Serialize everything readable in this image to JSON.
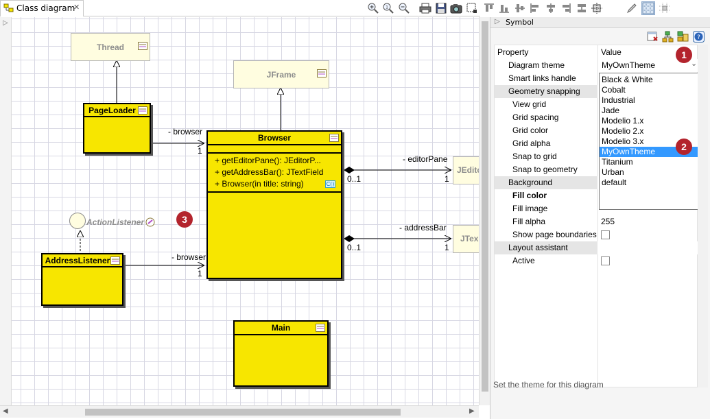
{
  "tab": {
    "title": "Class diagram",
    "close": "✕"
  },
  "toolbar": {
    "icons": [
      "zoom-in-icon",
      "zoom-reset-icon",
      "zoom-out-icon",
      "print-icon",
      "save-icon",
      "camera-icon",
      "select-icon",
      "align-top-icon",
      "align-bottom-icon",
      "align-middle-icon",
      "align-left-icon",
      "align-center-icon",
      "align-right-icon",
      "distribute-icon",
      "fit-icon",
      "pen-icon",
      "grid-icon",
      "snap-icon"
    ]
  },
  "diagram": {
    "classes": {
      "thread": "Thread",
      "jframe": "JFrame",
      "pageloader": "PageLoader",
      "browser": "Browser",
      "addresslistener": "AddressListener",
      "main": "Main",
      "jeditor": "JEdito",
      "jtext": "JTex"
    },
    "browser_ops": [
      "+ getEditorPane(): JEditorP...",
      "+ getAddressBar(): JTextField",
      "+ Browser(in title: string)"
    ],
    "interface": "ActionListener",
    "links": {
      "browser_from_pageloader": "- browser",
      "browser_from_addresslistener": "- browser",
      "editor_pane": "- editorPane",
      "address_bar": "- addressBar",
      "one": "1",
      "zero_one": "0..1"
    },
    "badge3": "3"
  },
  "panel": {
    "symbol_tab": "Symbol",
    "header": {
      "property": "Property",
      "value": "Value"
    },
    "rows": [
      {
        "name": "Diagram theme",
        "value": "",
        "kind": "prop"
      },
      {
        "name": "Smart links handle",
        "value": "",
        "kind": "prop"
      },
      {
        "name": "Geometry snapping",
        "value": "",
        "kind": "cat"
      },
      {
        "name": "View grid",
        "value": "",
        "kind": "sub"
      },
      {
        "name": "Grid spacing",
        "value": "",
        "kind": "sub"
      },
      {
        "name": "Grid color",
        "value": "",
        "kind": "sub"
      },
      {
        "name": "Grid alpha",
        "value": "",
        "kind": "sub"
      },
      {
        "name": "Snap to grid",
        "value": "",
        "kind": "sub"
      },
      {
        "name": "Snap to geometry",
        "value": "",
        "kind": "sub"
      },
      {
        "name": "Background",
        "value": "",
        "kind": "cat"
      },
      {
        "name": "Fill color",
        "value": "",
        "kind": "bold"
      },
      {
        "name": "Fill image",
        "value": "",
        "kind": "sub"
      },
      {
        "name": "Fill alpha",
        "value": "255",
        "kind": "sub"
      },
      {
        "name": "Show page boundaries",
        "value": "",
        "kind": "check"
      },
      {
        "name": "Layout assistant",
        "value": "",
        "kind": "cat"
      },
      {
        "name": "Active",
        "value": "",
        "kind": "check"
      }
    ],
    "theme_value": "MyOwnTheme",
    "theme_options": [
      "Black & White",
      "Cobalt",
      "Industrial",
      "Jade",
      "Modelio 1.x",
      "Modelio 2.x",
      "Modelio 3.x",
      "MyOwnTheme",
      "Titanium",
      "Urban",
      "default"
    ],
    "selected_option": "MyOwnTheme",
    "badge1": "1",
    "badge2": "2",
    "status": "Set the theme for this diagram"
  }
}
